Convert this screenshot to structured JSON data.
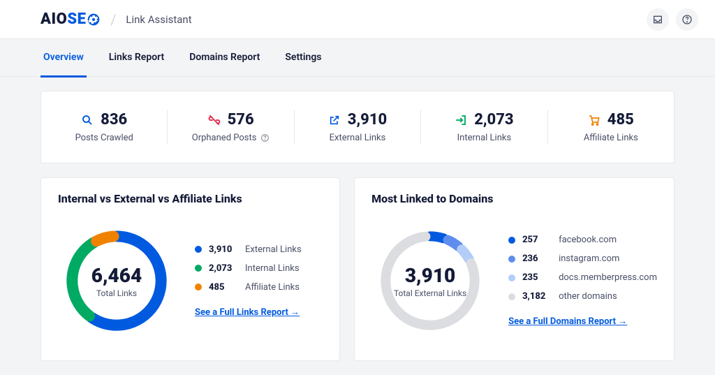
{
  "header": {
    "logo_part1": "AIO",
    "logo_part2": "SE",
    "crumb": "Link Assistant"
  },
  "tabs": [
    {
      "label": "Overview",
      "active": true
    },
    {
      "label": "Links Report",
      "active": false
    },
    {
      "label": "Domains Report",
      "active": false
    },
    {
      "label": "Settings",
      "active": false
    }
  ],
  "stats": [
    {
      "icon": "search",
      "value": "836",
      "label": "Posts Crawled",
      "color": "#005ae0"
    },
    {
      "icon": "unlink",
      "value": "576",
      "label": "Orphaned Posts",
      "help": true,
      "color": "#df2a4a"
    },
    {
      "icon": "external",
      "value": "3,910",
      "label": "External Links",
      "color": "#005ae0"
    },
    {
      "icon": "enter",
      "value": "2,073",
      "label": "Internal Links",
      "color": "#00aa63"
    },
    {
      "icon": "cart",
      "value": "485",
      "label": "Affiliate Links",
      "color": "#f18200"
    }
  ],
  "panelA": {
    "title": "Internal vs External vs Affiliate Links",
    "center_value": "6,464",
    "center_label": "Total Links",
    "legend": [
      {
        "value": "3,910",
        "label": "External Links",
        "color": "#005ae0"
      },
      {
        "value": "2,073",
        "label": "Internal Links",
        "color": "#00aa63"
      },
      {
        "value": "485",
        "label": "Affiliate Links",
        "color": "#f18200"
      }
    ],
    "link_text": "See a Full Links Report →"
  },
  "panelB": {
    "title": "Most Linked to Domains",
    "center_value": "3,910",
    "center_label": "Total External Links",
    "legend": [
      {
        "value": "257",
        "label": "facebook.com",
        "color": "#005ae0"
      },
      {
        "value": "236",
        "label": "instagram.com",
        "color": "#5f8dee"
      },
      {
        "value": "235",
        "label": "docs.memberpress.com",
        "color": "#b2cdf8"
      },
      {
        "value": "3,182",
        "label": "other domains",
        "color": "#dcdde1"
      }
    ],
    "link_text": "See a Full Domains Report →"
  },
  "chart_data": [
    {
      "type": "pie",
      "title": "Internal vs External vs Affiliate Links",
      "total_label": "Total Links",
      "total": 6464,
      "series": [
        {
          "name": "External Links",
          "value": 3910,
          "color": "#005ae0"
        },
        {
          "name": "Internal Links",
          "value": 2073,
          "color": "#00aa63"
        },
        {
          "name": "Affiliate Links",
          "value": 485,
          "color": "#f18200"
        }
      ]
    },
    {
      "type": "pie",
      "title": "Most Linked to Domains",
      "total_label": "Total External Links",
      "total": 3910,
      "series": [
        {
          "name": "facebook.com",
          "value": 257,
          "color": "#005ae0"
        },
        {
          "name": "instagram.com",
          "value": 236,
          "color": "#5f8dee"
        },
        {
          "name": "docs.memberpress.com",
          "value": 235,
          "color": "#b2cdf8"
        },
        {
          "name": "other domains",
          "value": 3182,
          "color": "#dcdde1"
        }
      ]
    }
  ]
}
